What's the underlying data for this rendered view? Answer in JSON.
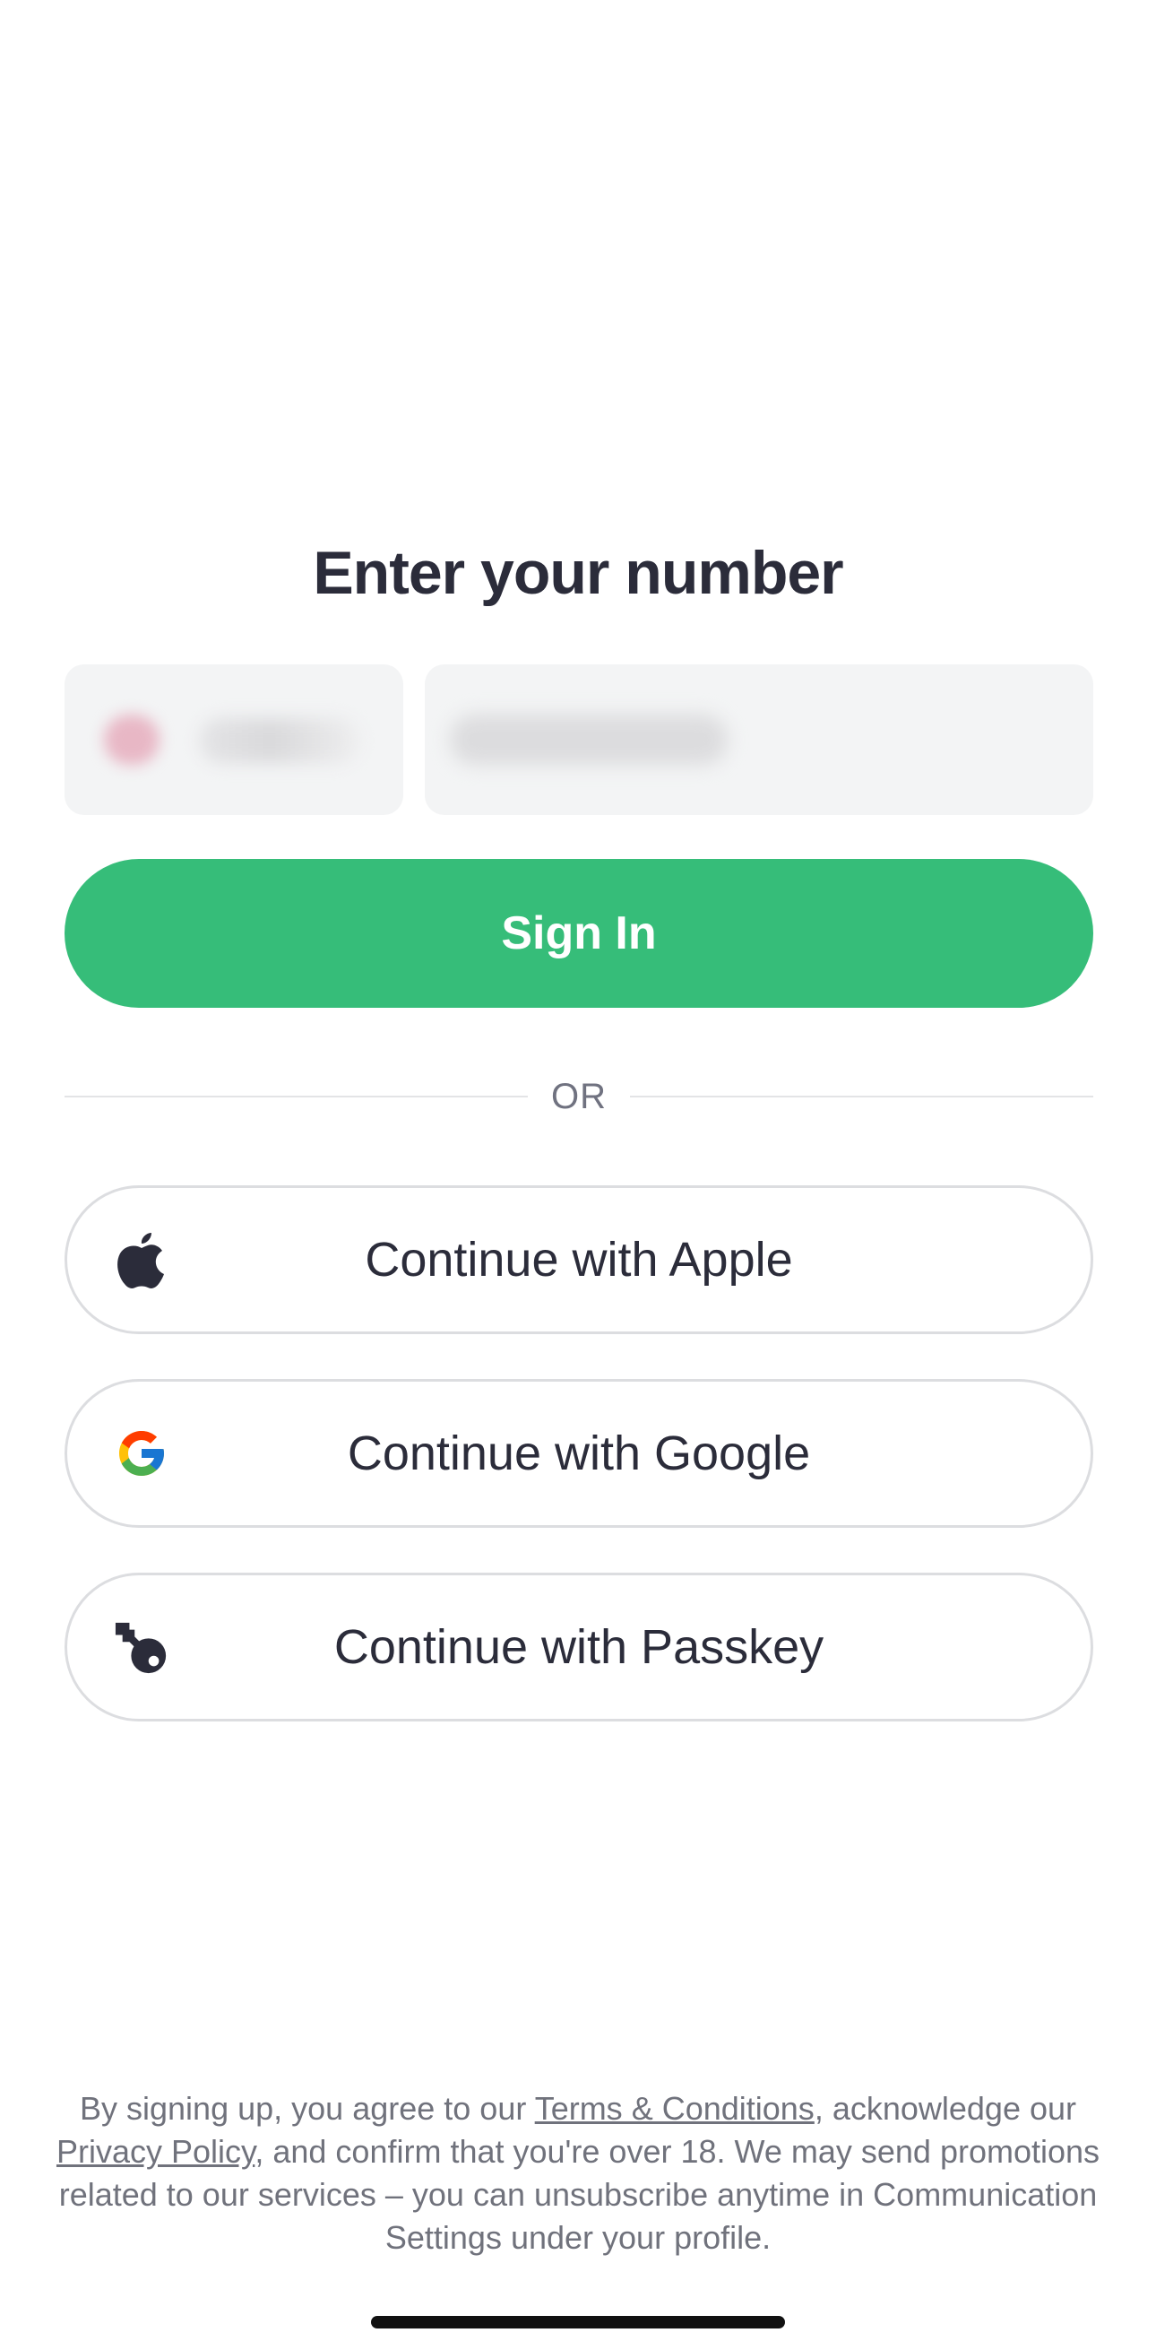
{
  "page": {
    "title": "Enter your number"
  },
  "phone_input": {
    "country_code_value": "",
    "number_value": ""
  },
  "sign_in": {
    "label": "Sign In",
    "color": "#36bd79"
  },
  "divider": {
    "label": "OR"
  },
  "social": {
    "apple": {
      "label": "Continue with Apple",
      "icon": "apple-icon"
    },
    "google": {
      "label": "Continue with Google",
      "icon": "google-icon"
    },
    "passkey": {
      "label": "Continue with Passkey",
      "icon": "passkey-icon"
    }
  },
  "legal": {
    "part1": "By signing up, you agree to our ",
    "terms_link": "Terms & Conditions",
    "part2": ", acknowledge our ",
    "privacy_link": "Privacy Policy",
    "part3": ", and confirm that you're over 18. We may send promotions related to our services – you can unsubscribe anytime in Communication Settings under your profile."
  }
}
